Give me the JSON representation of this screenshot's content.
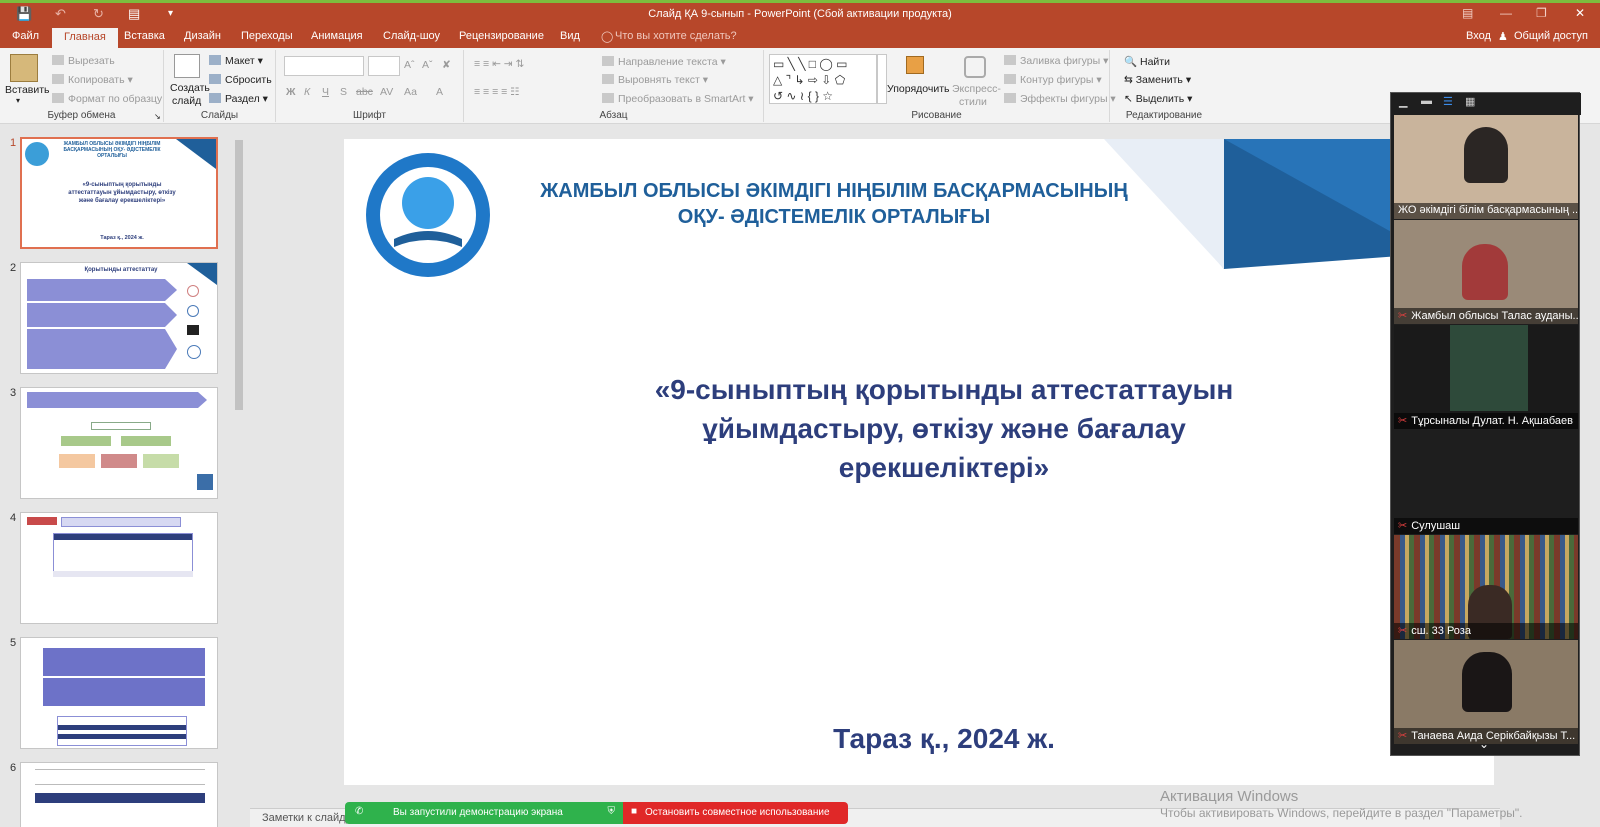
{
  "window": {
    "title": "Слайд ҚА 9-сынып - PowerPoint (Сбой активации продукта)",
    "qat": [
      "save-icon",
      "undo-icon",
      "redo-icon",
      "present-icon",
      "customize-icon"
    ]
  },
  "tabs": {
    "file": "Файл",
    "home": "Главная",
    "insert": "Вставка",
    "design": "Дизайн",
    "transitions": "Переходы",
    "animations": "Анимация",
    "slideshow": "Слайд-шоу",
    "review": "Рецензирование",
    "view": "Вид",
    "tellme": "Что вы хотите сделать?",
    "signin": "Вход",
    "share": "Общий доступ"
  },
  "ribbon": {
    "clipboard": {
      "label": "Буфер обмена",
      "paste": "Вставить",
      "cut": "Вырезать",
      "copy": "Копировать",
      "format_painter": "Формат по образцу"
    },
    "slides": {
      "label": "Слайды",
      "new_slide_1": "Создать",
      "new_slide_2": "слайд",
      "layout": "Макет",
      "reset": "Сбросить",
      "section": "Раздел"
    },
    "font": {
      "label": "Шрифт",
      "bold": "Ж",
      "italic": "К",
      "underline": "Ч",
      "shadow": "S",
      "strike": "abc",
      "spacing": "AV",
      "case": "Аа",
      "color": "A"
    },
    "paragraph": {
      "label": "Абзац",
      "text_direction": "Направление текста",
      "align_text": "Выровнять текст",
      "smartart": "Преобразовать в SmartArt"
    },
    "drawing": {
      "label": "Рисование",
      "arrange": "Упорядочить",
      "quick_styles_1": "Экспресс-",
      "quick_styles_2": "стили",
      "fill": "Заливка фигуры",
      "outline": "Контур фигуры",
      "effects": "Эффекты фигуры"
    },
    "editing": {
      "label": "Редактирование",
      "find": "Найти",
      "replace": "Заменить",
      "select": "Выделить"
    }
  },
  "thumbnails": {
    "numbers": [
      "1",
      "2",
      "3",
      "4",
      "5",
      "6"
    ],
    "t1": {
      "org": "ЖАМБЫЛ ОБЛЫСЫ ӘКІМДІГІ НІҢБІЛІМ БАСҚАРМАСЫНЫҢ ОҚУ- ӘДІСТЕМЕЛІК ОРТАЛЫҒЫ",
      "title": "«9-сыныптың қорытынды аттестаттауын ұйымдастыру, өткізу және бағалау ерекшеліктері»",
      "city": "Тараз қ., 2024 ж."
    },
    "t2": {
      "title": "Қорытынды аттестаттау"
    }
  },
  "slide": {
    "org_line1": "ЖАМБЫЛ ОБЛЫСЫ ӘКІМДІГІ НІҢБІЛІМ БАСҚАРМАСЫНЫҢ",
    "org_line2": "ОҚУ- ӘДІСТЕМЕЛІК ОРТАЛЫҒЫ",
    "title_line1": "«9-сыныптың қорытынды аттестаттауын",
    "title_line2": "ұйымдастыру, өткізу және бағалау",
    "title_line3": "ерекшеліктері»",
    "city": "Тараз қ., 2024 ж.",
    "logo": "education-department-logo"
  },
  "notes": {
    "placeholder": "Заметки к слайду"
  },
  "participants": [
    {
      "name": "ЖО әкімдігі білім басқармасының ...",
      "muted": false
    },
    {
      "name": "Жамбыл облысы Талас ауданы...",
      "muted": true
    },
    {
      "name": "Тұрсыналы Дулат. Н. Ақшабаев",
      "muted": true
    },
    {
      "name": "Сулушаш",
      "muted": true
    },
    {
      "name": "сш. 33 Роза",
      "muted": true
    },
    {
      "name": "Танаева Аида Серікбайқызы Т...",
      "muted": true
    }
  ],
  "share": {
    "status": "Вы запустили демонстрацию экрана",
    "stop": "Остановить совместное использование"
  },
  "activation": {
    "line1": "Активация Windows",
    "line2": "Чтобы активировать Windows, перейдите в раздел \"Параметры\"."
  },
  "colors": {
    "titlebar": "#b7472a",
    "slide_blue": "#1f5f9a",
    "slide_title": "#2d3e7c",
    "share_green": "#2fb24c",
    "share_red": "#e02828"
  }
}
